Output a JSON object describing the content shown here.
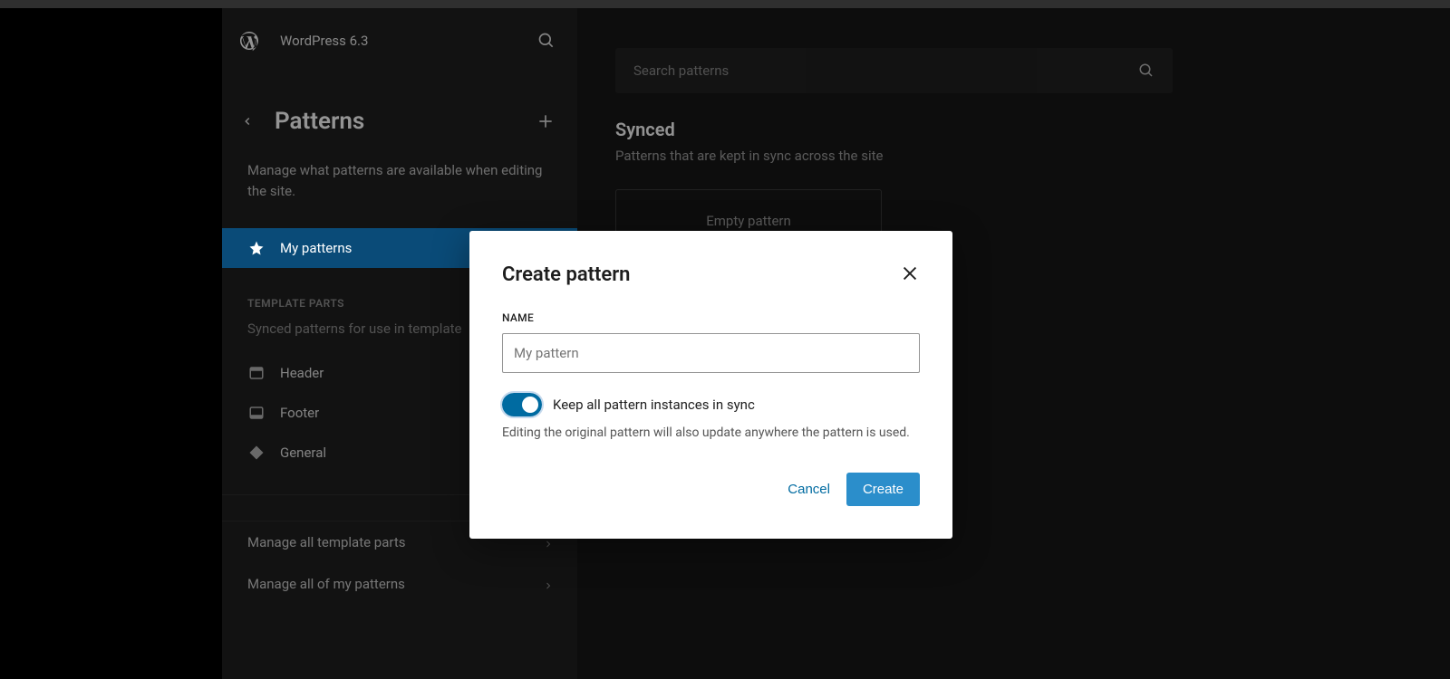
{
  "header": {
    "site_title": "WordPress 6.3"
  },
  "sidebar": {
    "section_title": "Patterns",
    "section_desc": "Manage what patterns are available when editing the site.",
    "nav": {
      "my_patterns": "My patterns"
    },
    "template_parts": {
      "group_label": "TEMPLATE PARTS",
      "group_desc": "Synced patterns for use in template",
      "items": {
        "header": "Header",
        "footer": "Footer",
        "general": "General"
      }
    },
    "manage": {
      "template_parts": "Manage all template parts",
      "my_patterns": "Manage all of my patterns"
    }
  },
  "main": {
    "search_placeholder": "Search patterns",
    "heading": "Synced",
    "subheading": "Patterns that are kept in sync across the site",
    "tile_label": "Empty pattern"
  },
  "modal": {
    "title": "Create pattern",
    "name_label": "NAME",
    "name_placeholder": "My pattern",
    "toggle_label": "Keep all pattern instances in sync",
    "toggle_desc": "Editing the original pattern will also update anywhere the pattern is used.",
    "cancel": "Cancel",
    "create": "Create"
  }
}
